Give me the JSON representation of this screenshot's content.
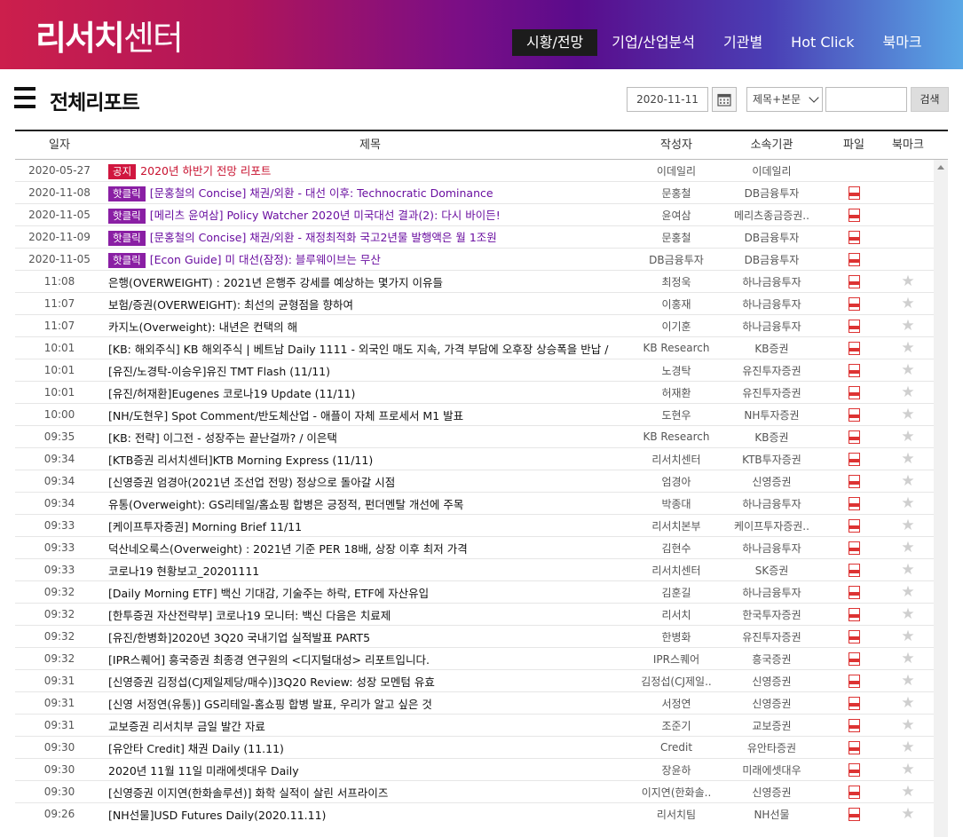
{
  "header": {
    "logo_bold": "리서치",
    "logo_light": "센터",
    "nav": [
      {
        "label": "시황/전망",
        "active": true
      },
      {
        "label": "기업/산업분석",
        "active": false
      },
      {
        "label": "기관별",
        "active": false
      },
      {
        "label": "Hot Click",
        "active": false
      },
      {
        "label": "북마크",
        "active": false
      }
    ]
  },
  "page": {
    "title": "전체리포트"
  },
  "search": {
    "date": "2020-11-11",
    "scope": "제목+본문",
    "button": "검색"
  },
  "table": {
    "headers": {
      "date": "일자",
      "title": "제목",
      "author": "작성자",
      "org": "소속기관",
      "file": "파일",
      "bookmark": "북마크"
    },
    "rows": [
      {
        "date": "2020-05-27",
        "badge": "공지",
        "kind": "notice",
        "title": "2020년 하반기 전망 리포트",
        "author": "이데일리",
        "org": "이데일리",
        "pdf": false,
        "star": false
      },
      {
        "date": "2020-11-08",
        "badge": "핫클릭",
        "kind": "pinned",
        "title": "[문홍철의 Concise] 채권/외환 - 대선 이후: Technocratic Dominance",
        "author": "문홍철",
        "org": "DB금융투자",
        "pdf": true,
        "star": false
      },
      {
        "date": "2020-11-05",
        "badge": "핫클릭",
        "kind": "pinned",
        "title": "[메리츠 윤여삼] Policy Watcher 2020년 미국대선 결과(2): 다시 바이든!",
        "author": "윤여삼",
        "org": "메리츠종금증권..",
        "pdf": true,
        "star": false
      },
      {
        "date": "2020-11-09",
        "badge": "핫클릭",
        "kind": "pinned",
        "title": "[문홍철의 Concise] 채권/외환 - 재정최적화 국고2년물 발행액은 월 1조원",
        "author": "문홍철",
        "org": "DB금융투자",
        "pdf": true,
        "star": false
      },
      {
        "date": "2020-11-05",
        "badge": "핫클릭",
        "kind": "pinned",
        "title": "[Econ Guide] 미 대선(잠정): 블루웨이브는 무산",
        "author": "DB금융투자",
        "org": "DB금융투자",
        "pdf": true,
        "star": false
      },
      {
        "date": "11:08",
        "badge": "",
        "kind": "normal",
        "title": "은행(OVERWEIGHT) : 2021년 은행주 강세를 예상하는 몇가지 이유들",
        "author": "최정욱",
        "org": "하나금융투자",
        "pdf": true,
        "star": true
      },
      {
        "date": "11:07",
        "badge": "",
        "kind": "normal",
        "title": "보험/증권(OVERWEIGHT): 최선의 균형점을 향하여",
        "author": "이홍재",
        "org": "하나금융투자",
        "pdf": true,
        "star": true
      },
      {
        "date": "11:07",
        "badge": "",
        "kind": "normal",
        "title": "카지노(Overweight): 내년은 컨택의 해",
        "author": "이기훈",
        "org": "하나금융투자",
        "pdf": true,
        "star": true
      },
      {
        "date": "10:01",
        "badge": "",
        "kind": "normal",
        "title": "[KB: 해외주식] KB 해외주식 | 베트남 Daily 1111 - 외국인 매도 지속, 가격 부담에 오후장 상승폭을 반납 /",
        "author": "KB Research",
        "org": "KB증권",
        "pdf": true,
        "star": true
      },
      {
        "date": "10:01",
        "badge": "",
        "kind": "normal",
        "title": "[유진/노경탁-이승우]유진 TMT Flash (11/11)",
        "author": "노경탁",
        "org": "유진투자증권",
        "pdf": true,
        "star": true
      },
      {
        "date": "10:01",
        "badge": "",
        "kind": "normal",
        "title": "[유진/허재환]Eugenes 코로나19 Update (11/11)",
        "author": "허재환",
        "org": "유진투자증권",
        "pdf": true,
        "star": true
      },
      {
        "date": "10:00",
        "badge": "",
        "kind": "normal",
        "title": "[NH/도현우] Spot Comment/반도체산업 - 애플이 자체 프로세서 M1 발표",
        "author": "도현우",
        "org": "NH투자증권",
        "pdf": true,
        "star": true
      },
      {
        "date": "09:35",
        "badge": "",
        "kind": "normal",
        "title": "[KB: 전략] 이그전 - 성장주는 끝난걸까? / 이은택",
        "author": "KB Research",
        "org": "KB증권",
        "pdf": true,
        "star": true
      },
      {
        "date": "09:34",
        "badge": "",
        "kind": "normal",
        "title": "[KTB증권 리서치센터]KTB Morning Express (11/11)",
        "author": "리서치센터",
        "org": "KTB투자증권",
        "pdf": true,
        "star": true
      },
      {
        "date": "09:34",
        "badge": "",
        "kind": "normal",
        "title": "[신영증권 엄경아(2021년 조선업 전망) 정상으로 돌아갈 시점",
        "author": "엄경아",
        "org": "신영증권",
        "pdf": true,
        "star": true
      },
      {
        "date": "09:34",
        "badge": "",
        "kind": "normal",
        "title": "유통(Overweight): GS리테일/홈쇼핑 합병은 긍정적, 펀더멘탈 개선에 주목",
        "author": "박종대",
        "org": "하나금융투자",
        "pdf": true,
        "star": true
      },
      {
        "date": "09:33",
        "badge": "",
        "kind": "normal",
        "title": "[케이프투자증권] Morning Brief 11/11",
        "author": "리서치본부",
        "org": "케이프투자증권..",
        "pdf": true,
        "star": true
      },
      {
        "date": "09:33",
        "badge": "",
        "kind": "normal",
        "title": "덕산네오룩스(Overweight) : 2021년 기준 PER 18배, 상장 이후 최저 가격",
        "author": "김현수",
        "org": "하나금융투자",
        "pdf": true,
        "star": true
      },
      {
        "date": "09:33",
        "badge": "",
        "kind": "normal",
        "title": "코로나19 현황보고_20201111",
        "author": "리서치센터",
        "org": "SK증권",
        "pdf": true,
        "star": true
      },
      {
        "date": "09:32",
        "badge": "",
        "kind": "normal",
        "title": "[Daily Morning ETF] 백신 기대감, 기술주는 하락, ETF에 자산유입",
        "author": "김훈길",
        "org": "하나금융투자",
        "pdf": true,
        "star": true
      },
      {
        "date": "09:32",
        "badge": "",
        "kind": "normal",
        "title": "[한투증권 자산전략부] 코로나19 모니터: 백신 다음은 치료제",
        "author": "리서치",
        "org": "한국투자증권",
        "pdf": true,
        "star": true
      },
      {
        "date": "09:32",
        "badge": "",
        "kind": "normal",
        "title": "[유진/한병화]2020년 3Q20 국내기업 실적발표 PART5",
        "author": "한병화",
        "org": "유진투자증권",
        "pdf": true,
        "star": true
      },
      {
        "date": "09:32",
        "badge": "",
        "kind": "normal",
        "title": "[IPR스퀘어] 흥국증권 최종경 연구원의 <디지털대성> 리포트입니다.",
        "author": "IPR스퀘어",
        "org": "흥국증권",
        "pdf": true,
        "star": true
      },
      {
        "date": "09:31",
        "badge": "",
        "kind": "normal",
        "title": "[신영증권 김정섭(CJ제일제당/매수)]3Q20 Review: 성장 모멘텀 유효",
        "author": "김정섭(CJ제일..",
        "org": "신영증권",
        "pdf": true,
        "star": true
      },
      {
        "date": "09:31",
        "badge": "",
        "kind": "normal",
        "title": "[신영 서정연(유통)] GS리테일-홈쇼핑 합병 발표, 우리가 알고 싶은 것",
        "author": "서정연",
        "org": "신영증권",
        "pdf": true,
        "star": true
      },
      {
        "date": "09:31",
        "badge": "",
        "kind": "normal",
        "title": "교보증권 리서치부 금일 발간 자료",
        "author": "조준기",
        "org": "교보증권",
        "pdf": true,
        "star": true
      },
      {
        "date": "09:30",
        "badge": "",
        "kind": "normal",
        "title": "[유안타 Credit] 채권 Daily (11.11)",
        "author": "Credit",
        "org": "유안타증권",
        "pdf": true,
        "star": true
      },
      {
        "date": "09:30",
        "badge": "",
        "kind": "normal",
        "title": "2020년 11월 11일 미래에셋대우 Daily",
        "author": "장윤하",
        "org": "미래에셋대우",
        "pdf": true,
        "star": true
      },
      {
        "date": "09:30",
        "badge": "",
        "kind": "normal",
        "title": "[신영증권 이지연(한화솔루션)] 화학 실적이 살린 서프라이즈",
        "author": "이지연(한화솔..",
        "org": "신영증권",
        "pdf": true,
        "star": true
      },
      {
        "date": "09:26",
        "badge": "",
        "kind": "normal",
        "title": "[NH선물]USD Futures Daily(2020.11.11)",
        "author": "리서치팀",
        "org": "NH선물",
        "pdf": true,
        "star": true
      }
    ]
  }
}
